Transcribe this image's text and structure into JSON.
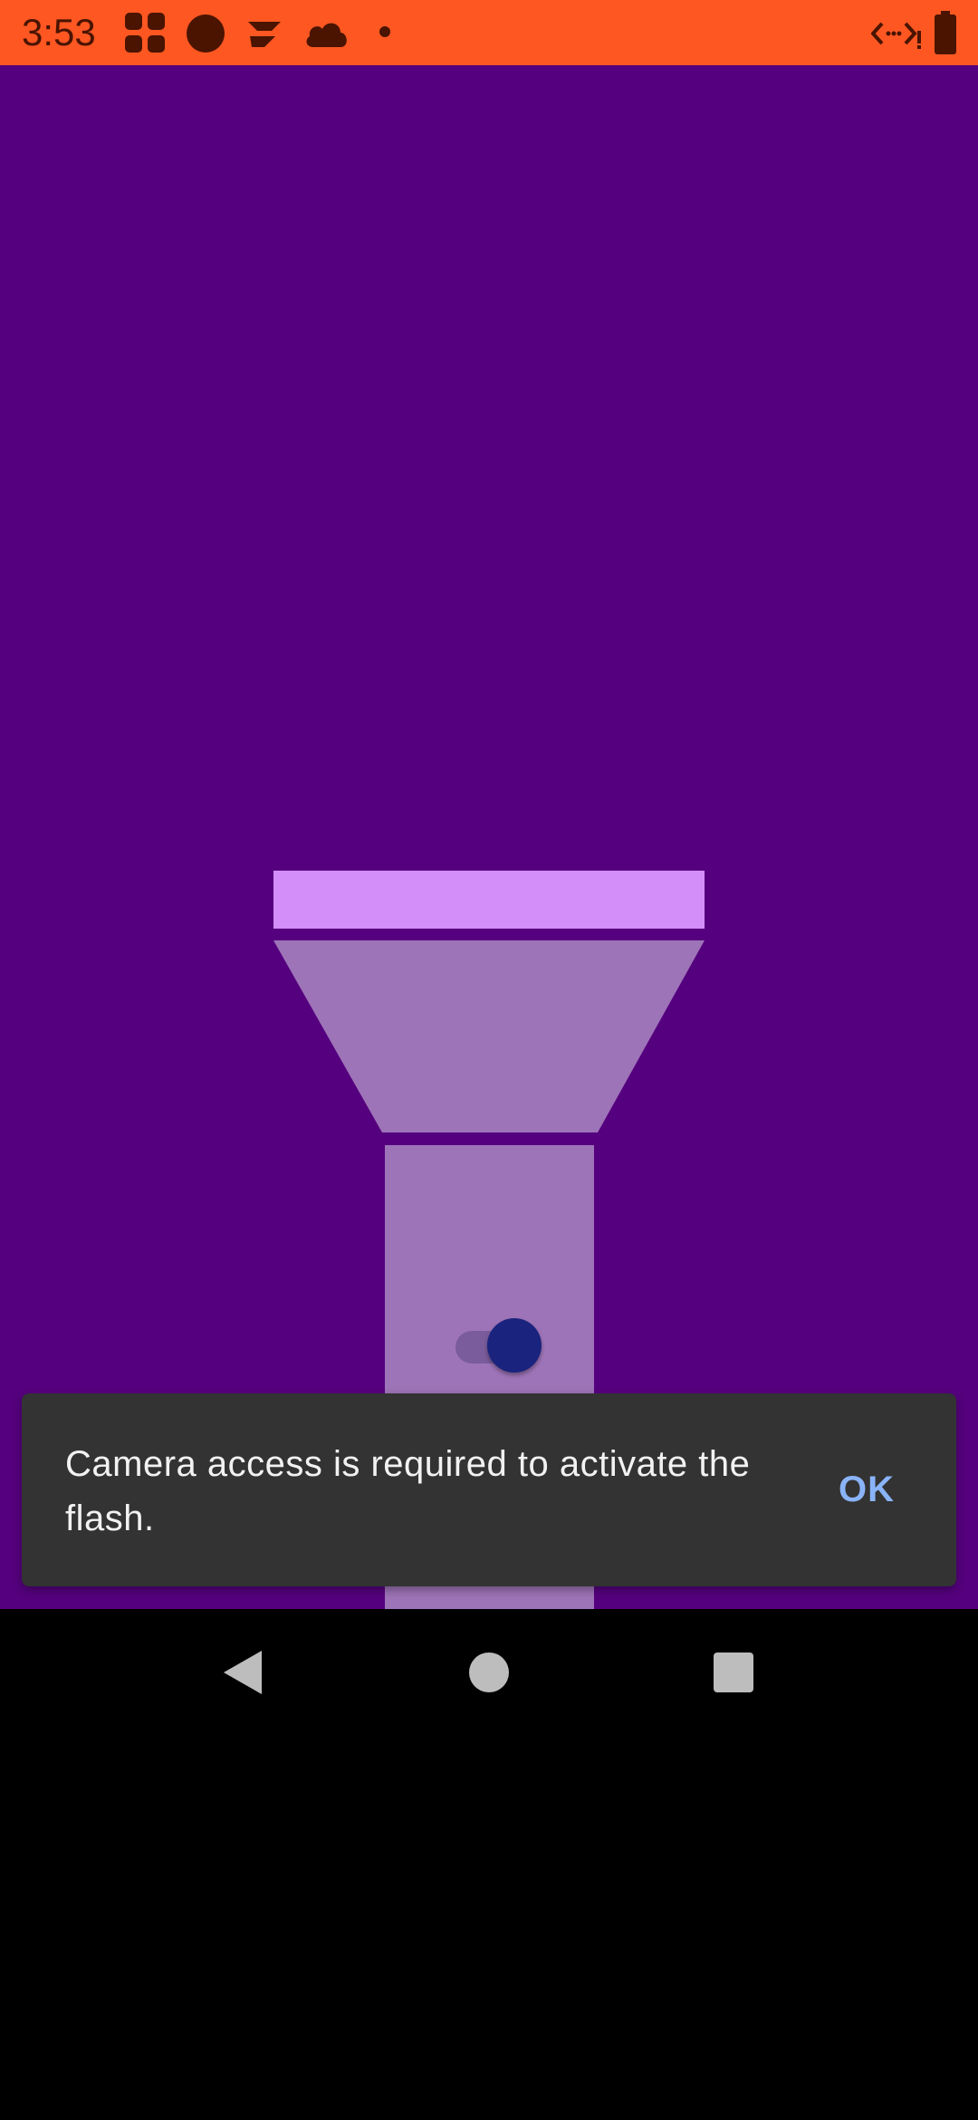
{
  "status_bar": {
    "time": "3:53",
    "background": "#FF5722",
    "icons_left": [
      "app-grid-icon",
      "circle-icon",
      "logo-icon",
      "cloud-icon",
      "dot-icon"
    ],
    "icons_right": [
      "code-icon",
      "battery-icon"
    ]
  },
  "app": {
    "background": "#55007E",
    "flash_switch": {
      "state": "on",
      "thumb_color": "#1A237E"
    }
  },
  "snackbar": {
    "message": "Camera access is required to activate the flash.",
    "action": "OK"
  },
  "nav_bar": {
    "buttons": [
      "back-icon",
      "home-icon",
      "recents-icon"
    ]
  }
}
